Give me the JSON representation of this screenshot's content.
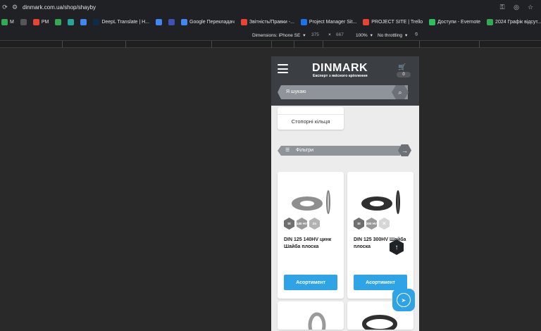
{
  "browser": {
    "url": "dinmark.com.ua/shop/shayby",
    "bookmarks": [
      {
        "label": "M",
        "color": "#34a853"
      },
      {
        "label": "",
        "color": "#555555"
      },
      {
        "label": "PM",
        "color": "#ea4335"
      },
      {
        "label": "",
        "color": "#34a853"
      },
      {
        "label": "",
        "color": "#26a69a"
      },
      {
        "label": "",
        "color": "#4285f4"
      },
      {
        "label": "DeepL Translate | H...",
        "color": "#0f2b46"
      },
      {
        "label": "",
        "color": "#4285f4"
      },
      {
        "label": "",
        "color": "#3f51b5"
      },
      {
        "label": "Google Перекладач",
        "color": "#4285f4"
      },
      {
        "label": "Звітність/Правки -...",
        "color": "#ea4335"
      },
      {
        "label": "Project Manager Sit...",
        "color": "#1a73e8"
      },
      {
        "label": "PROJECT SITE | Trello",
        "color": "#ea4335"
      },
      {
        "label": "Доступи - Evernote",
        "color": "#2dbe60"
      },
      {
        "label": "2024 Графік відсут...",
        "color": "#34a853"
      }
    ]
  },
  "devtools": {
    "dimensions_label": "Dimensions: iPhone SE",
    "width": "375",
    "times": "×",
    "height": "667",
    "zoom": "100%",
    "throttling": "No throttling"
  },
  "site": {
    "logo": "DINMARK",
    "tagline": "Експерт з якісного кріплення",
    "cart_count": "0",
    "search_placeholder": "Я шукаю",
    "category_label": "Стопорні кільця",
    "filters_label": "Фільтри",
    "products": [
      {
        "name": "DIN 125 140HV цинк Шайба плоска",
        "button": "Асортимент",
        "badges": [
          "St",
          "140 HV",
          "Zn"
        ],
        "washer_color": "#8e8e8e"
      },
      {
        "name": "DIN 125 300HV Шайба плоска",
        "button": "Асортимент",
        "badges": [
          "St",
          "300 HV",
          ""
        ],
        "washer_color": "#3a3a3a"
      }
    ]
  },
  "colors": {
    "header_bg": "#3b3f44",
    "accent_blue": "#2ea3e6",
    "grey_pill": "#8e9499"
  },
  "icons": {
    "menu": "hamburger-icon",
    "cart": "cart-icon",
    "search": "search-icon",
    "filter": "sliders-icon",
    "arrow": "arrow-right-icon",
    "scroll_top": "arrow-up-icon",
    "telegram": "telegram-icon"
  }
}
